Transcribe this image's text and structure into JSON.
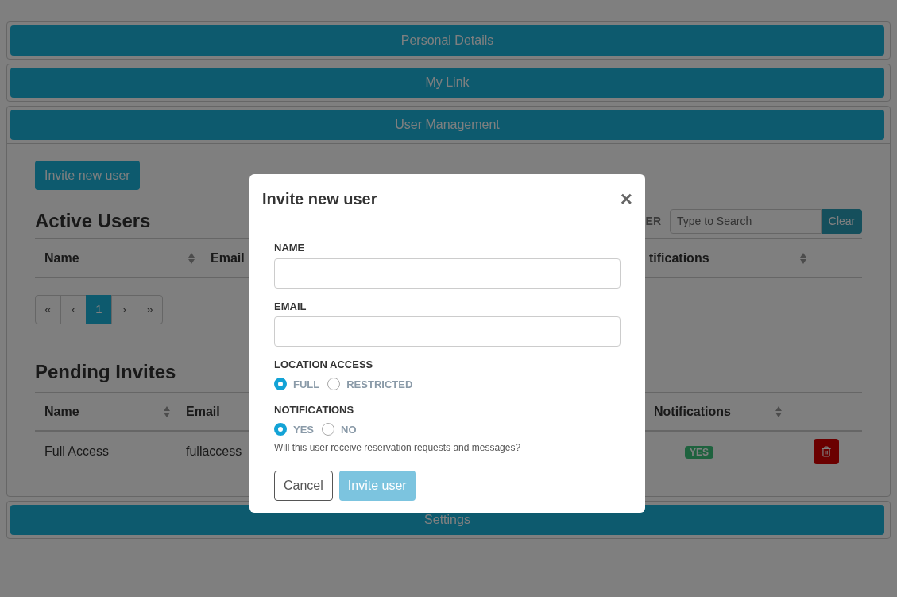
{
  "accordion": [
    {
      "title": "Personal Details"
    },
    {
      "title": "My Link"
    },
    {
      "title": "User Management",
      "panel": {
        "invite_button": "Invite new user",
        "active_users": {
          "title": "Active Users",
          "filter_label": "ER",
          "search_placeholder": "Type to Search",
          "clear_button": "Clear",
          "columns": [
            {
              "label": "Name"
            },
            {
              "label": "Email"
            },
            {
              "label": "tifications"
            }
          ],
          "pagination": [
            {
              "label": "«",
              "selected": false
            },
            {
              "label": "‹",
              "selected": false
            },
            {
              "label": "1",
              "selected": true
            },
            {
              "label": "›",
              "selected": false
            },
            {
              "label": "»",
              "selected": false
            }
          ]
        },
        "pending_invites": {
          "title": "Pending Invites",
          "columns": [
            {
              "label": "Name"
            },
            {
              "label": "Email"
            },
            {
              "label": "Notifications"
            }
          ],
          "rows": [
            {
              "name": "Full Access",
              "email": "fullaccess",
              "notifications": "YES"
            }
          ]
        }
      }
    },
    {
      "title": "Settings"
    }
  ],
  "modal": {
    "title": "Invite new user",
    "close": "×",
    "fields": [
      {
        "label": "NAME"
      },
      {
        "label": "EMAIL"
      }
    ],
    "radio_groups": [
      {
        "label": "LOCATION ACCESS",
        "options": [
          {
            "label": "FULL",
            "selected": true
          },
          {
            "label": "RESTRICTED",
            "selected": false
          }
        ]
      },
      {
        "label": "NOTIFICATIONS",
        "options": [
          {
            "label": "YES",
            "selected": true
          },
          {
            "label": "NO",
            "selected": false
          }
        ],
        "help": "Will this user receive reservation requests and messages?"
      }
    ],
    "buttons": [
      {
        "label": "Cancel",
        "kind": "secondary",
        "disabled": false
      },
      {
        "label": "Invite user",
        "kind": "primary",
        "disabled": true
      }
    ]
  }
}
